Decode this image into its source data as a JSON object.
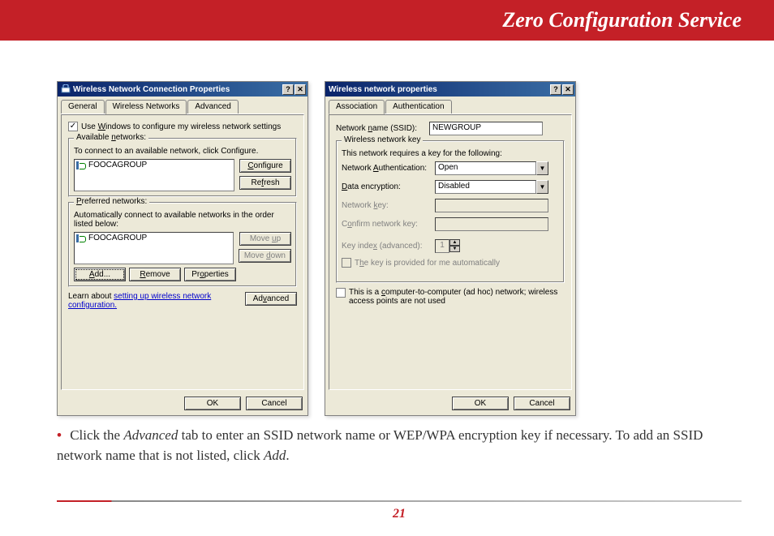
{
  "header": {
    "title": "Zero Configuration Service"
  },
  "dialog1": {
    "title": "Wireless Network Connection Properties",
    "help_btn": "?",
    "close_btn": "✕",
    "tabs": {
      "general": "General",
      "wireless": "Wireless Networks",
      "advanced": "Advanced"
    },
    "use_windows": "Use Windows to configure my wireless network settings",
    "available": {
      "legend": "Available networks:",
      "hint": "To connect to an available network, click Configure.",
      "item": "FOOCAGROUP",
      "configure": "Configure",
      "refresh": "Refresh"
    },
    "preferred": {
      "legend": "Preferred networks:",
      "hint": "Automatically connect to available networks in the order listed below:",
      "item": "FOOCAGROUP",
      "moveup": "Move up",
      "movedown": "Move down",
      "add": "Add...",
      "remove": "Remove",
      "properties": "Properties"
    },
    "learn_prefix": "Learn about ",
    "learn_link": "setting up wireless network configuration.",
    "advanced_btn": "Advanced",
    "ok": "OK",
    "cancel": "Cancel"
  },
  "dialog2": {
    "title": "Wireless network properties",
    "help_btn": "?",
    "close_btn": "✕",
    "tabs": {
      "association": "Association",
      "authentication": "Authentication"
    },
    "ssid_label": "Network name (SSID):",
    "ssid_value": "NEWGROUP",
    "key_group": {
      "legend": "Wireless network key",
      "hint": "This network requires a key for the following:",
      "auth_label": "Network Authentication:",
      "auth_value": "Open",
      "enc_label": "Data encryption:",
      "enc_value": "Disabled",
      "netkey_label": "Network key:",
      "confirm_label": "Confirm network key:",
      "keyindex_label": "Key index (advanced):",
      "keyindex_value": "1",
      "auto_key": "The key is provided for me automatically"
    },
    "adhoc": "This is a computer-to-computer (ad hoc) network; wireless access points are not used",
    "ok": "OK",
    "cancel": "Cancel"
  },
  "instruction": {
    "bullet": "•",
    "t1": "Click the ",
    "advanced": "Advanced",
    "t2": " tab to enter an SSID network name or WEP/WPA encryption key if necessary.  To add an SSID network name that is not listed, click ",
    "add": "Add",
    "t3": "."
  },
  "page_number": "21"
}
